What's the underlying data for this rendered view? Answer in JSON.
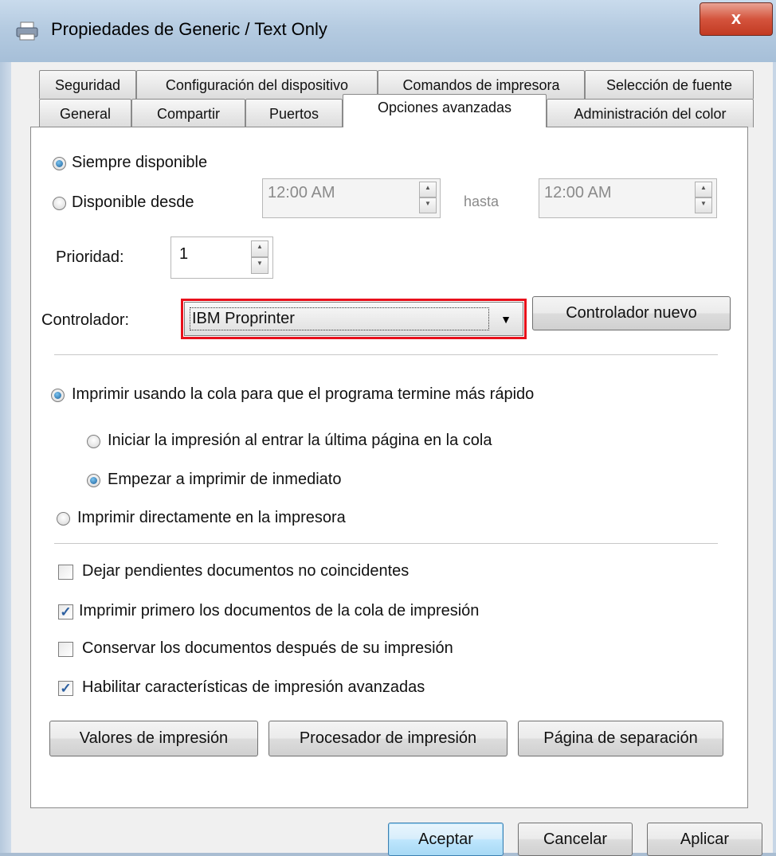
{
  "window": {
    "title": "Propiedades de Generic / Text Only",
    "close_label": "x"
  },
  "tabs_row1": [
    "Seguridad",
    "Configuración del dispositivo",
    "Comandos de impresora",
    "Selección de fuente"
  ],
  "tabs_row2": [
    "General",
    "Compartir",
    "Puertos",
    "Opciones avanzadas",
    "Administración del color"
  ],
  "availability": {
    "always": "Siempre disponible",
    "from": "Disponible desde",
    "from_time": "12:00 AM",
    "until_label": "hasta",
    "until_time": "12:00 AM"
  },
  "priority": {
    "label": "Prioridad:",
    "value": "1"
  },
  "driver": {
    "label": "Controlador:",
    "value": "IBM Proprinter",
    "new_button": "Controlador nuevo"
  },
  "spool": {
    "use_spool": "Imprimir usando la cola para que el programa termine más rápido",
    "start_after_last": "Iniciar la impresión al entrar la última página en la cola",
    "start_immediately": "Empezar a imprimir de inmediato",
    "print_direct": "Imprimir directamente en la impresora"
  },
  "options": {
    "hold_mismatched": "Dejar pendientes documentos no coincidentes",
    "print_spooled_first": "Imprimir primero los documentos de la cola de impresión",
    "keep_printed": "Conservar los documentos después de su impresión",
    "enable_advanced": "Habilitar características de impresión avanzadas"
  },
  "panel_buttons": {
    "defaults": "Valores de impresión",
    "processor": "Procesador de impresión",
    "separator": "Página de separación"
  },
  "dialog_buttons": {
    "ok": "Aceptar",
    "cancel": "Cancelar",
    "apply": "Aplicar"
  },
  "colors": {
    "highlight": "#e8101b",
    "default_button": "#3c7fb1"
  }
}
